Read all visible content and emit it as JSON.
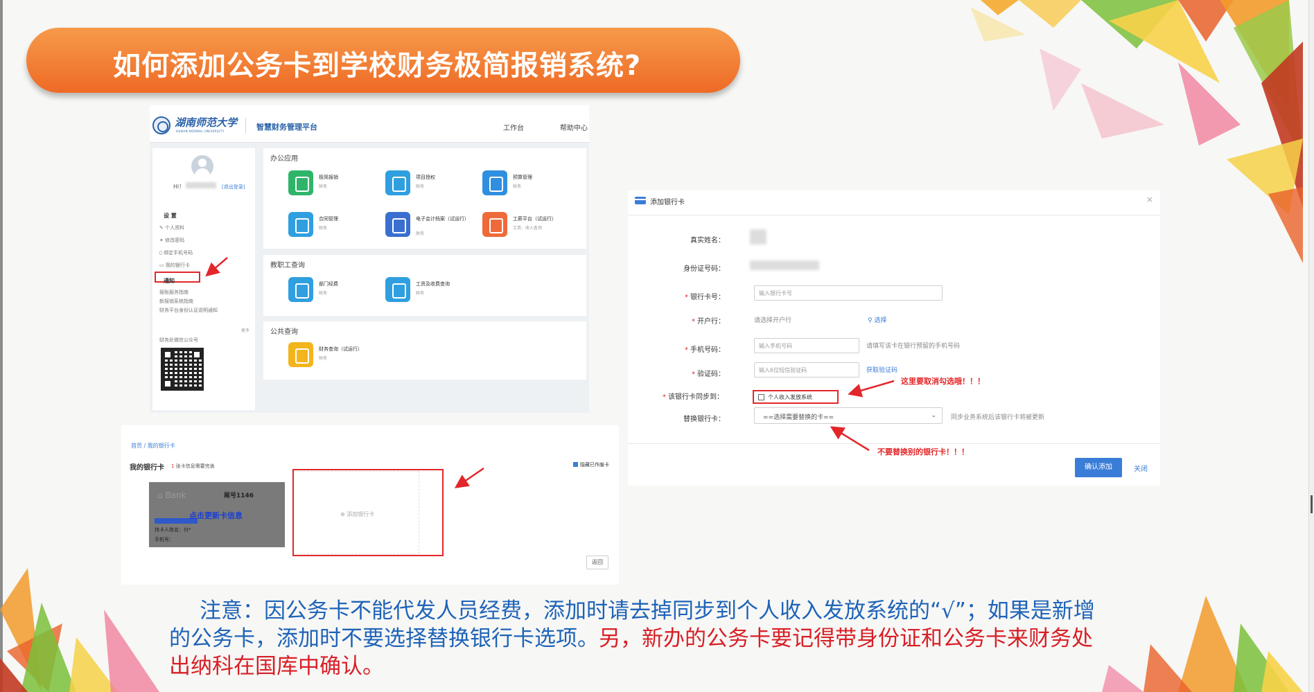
{
  "slide": {
    "title": "如何添加公务卡到学校财务极简报销系统?",
    "note": {
      "part1": "注意：因公务卡不能代发人员经费，添加时请去掉同步到个人收入发放系统的“√”；如果是新增的公务卡，添加时不要选择替换银行卡选项。",
      "part2": "另，新办的公务卡要记得带身份证和公务卡来财务处出纳科在国库中确认。"
    }
  },
  "portal": {
    "logo_cn": "湖南师范大学",
    "logo_en": "HUNAN NORMAL UNIVERSITY",
    "platform_name": "智慧财务管理平台",
    "nav": {
      "work": "工作台",
      "help": "帮助中心"
    },
    "sidebar": {
      "greeting": "Hi！",
      "logout": "[退出登录]",
      "settings_heading": "设 置",
      "settings_items": [
        "个人资料",
        "修改密码",
        "绑定手机号码",
        "我的银行卡"
      ],
      "notice_heading": "通知",
      "notice_items": [
        "报账服务指南",
        "新报销系统指南",
        "财务平台身份认证说明通知"
      ],
      "more": "更多",
      "wechat_label": "财务处微信公众号"
    },
    "sections": {
      "office": {
        "title": "办公应用",
        "apps": [
          {
            "name": "极简报销",
            "sub": "财务"
          },
          {
            "name": "项目授权",
            "sub": "财务"
          },
          {
            "name": "预算管理",
            "sub": "财务"
          },
          {
            "name": "合同管理",
            "sub": "财务"
          },
          {
            "name": "电子会计档案（试运行）",
            "sub": "财务"
          },
          {
            "name": "工薪平台（试运行）",
            "sub": "工资、收入查询"
          }
        ]
      },
      "staff": {
        "title": "教职工查询",
        "apps": [
          {
            "name": "部门经费",
            "sub": "财务"
          },
          {
            "name": "工资及收费查询",
            "sub": "财务"
          }
        ]
      },
      "public": {
        "title": "公共查询",
        "apps": [
          {
            "name": "财务查询（试运行）",
            "sub": "财务"
          }
        ]
      }
    }
  },
  "dialog": {
    "title": "添加银行卡",
    "close_symbol": "×",
    "fields": {
      "real_name": "真实姓名：",
      "id_number": "身份证号码：",
      "card_number": "银行卡号：",
      "card_number_placeholder": "输入银行卡号",
      "bank": "开户行：",
      "bank_value": "请选择开户行",
      "bank_select": "选择",
      "phone": "手机号码：",
      "phone_placeholder": "输入手机号码",
      "phone_hint": "请填写该卡在银行预留的手机号码",
      "code": "验证码：",
      "code_placeholder": "输入6位短信验证码",
      "get_code": "获取验证码",
      "sync": "该银行卡同步到：",
      "sync_option": "个人收入发放系统",
      "replace": "替换银行卡：",
      "replace_value": "==选择需要替换的卡==",
      "replace_hint": "同步业务系统后该银行卡将被更新"
    },
    "buttons": {
      "confirm": "确认添加",
      "close": "关闭"
    },
    "annotations": {
      "uncheck": "这里要取消勾选哦！！！",
      "no_replace": "不要替换别的银行卡！！！"
    },
    "required_mark": "*"
  },
  "mycards": {
    "breadcrumb": "首页 / 我的银行卡",
    "title": "我的银行卡",
    "note_count": "1",
    "note_rest": "张卡信息需要完善",
    "hide_deleted": "隐藏已作废卡",
    "card": {
      "bank": "Bank",
      "tail": "尾号1146",
      "update": "点击更新卡信息",
      "owner": "持卡人姓名：付*",
      "phone": "手机号："
    },
    "add_card": "添加银行卡",
    "back": "返回"
  }
}
